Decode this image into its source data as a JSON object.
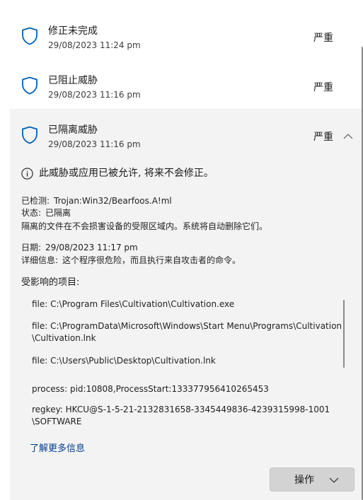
{
  "threats": [
    {
      "title": "修正未完成",
      "date": "29/08/2023 11:24 pm",
      "severity": "严重"
    },
    {
      "title": "已阻止威胁",
      "date": "29/08/2023 11:16 pm",
      "severity": "严重"
    },
    {
      "title": "已隔离威胁",
      "date": "29/08/2023 11:16 pm",
      "severity": "严重"
    }
  ],
  "expanded": {
    "info_message": "此威胁或应用已被允许, 将来不会修正。",
    "detected_label": "已检测:",
    "detected_value": "Trojan:Win32/Bearfoos.A!ml",
    "status_label": "状态:",
    "status_value": "已隔离",
    "quarantine_note": "隔离的文件在不会损害设备的受限区域内。系统将自动删除它们。",
    "date_label": "日期:",
    "date_value": "29/08/2023 11:17 pm",
    "details_label": "详细信息:",
    "details_value": "这个程序很危险，而且执行来自攻击者的命令。",
    "affected_title": "受影响的项目:",
    "affected_items": [
      "file: C:\\Program Files\\Cultivation\\Cultivation.exe",
      "file: C:\\ProgramData\\Microsoft\\Windows\\Start Menu\\Programs\\Cultivation\\Cultivation.lnk",
      "file: C:\\Users\\Public\\Desktop\\Cultivation.lnk",
      "process: pid:10808,ProcessStart:133377956410265453",
      "regkey: HKCU@S-1-5-21-2132831658-3345449836-4239315998-1001\\SOFTWARE"
    ],
    "learn_more": "了解更多信息",
    "action_button": "操作"
  },
  "colors": {
    "accent": "#005fb8",
    "link": "#003e92",
    "expanded_bg": "#f3f3f3",
    "button_bg": "#d3d3d3"
  },
  "icons": {
    "threat": "shield-icon",
    "info": "info-icon",
    "collapse": "chevron-up-icon",
    "dropdown": "chevron-down-icon"
  }
}
